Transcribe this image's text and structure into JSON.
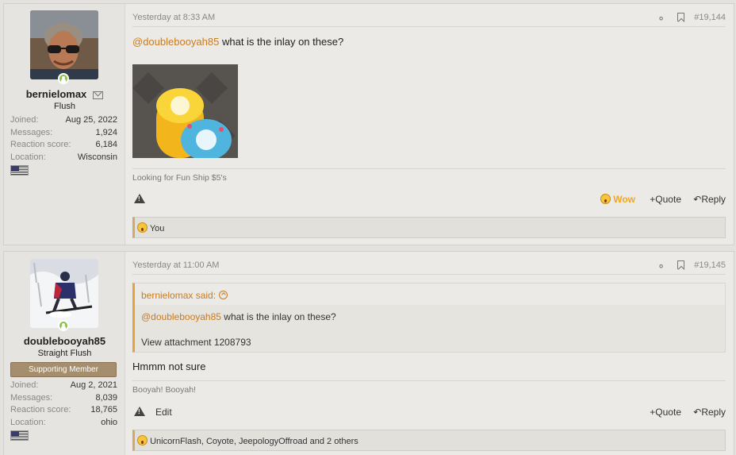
{
  "posts": [
    {
      "user": {
        "name": "bernielomax",
        "title": "Flush",
        "stats": [
          {
            "label": "Joined:",
            "value": "Aug 25, 2022"
          },
          {
            "label": "Messages:",
            "value": "1,924"
          },
          {
            "label": "Reaction score:",
            "value": "6,184"
          },
          {
            "label": "Location:",
            "value": "Wisconsin"
          }
        ]
      },
      "date": "Yesterday at 8:33 AM",
      "number": "#19,144",
      "mention": "@doublebooyah85",
      "text": " what is the inlay on these?",
      "signature": "Looking for Fun Ship $5's",
      "actions": {
        "wow": "Wow",
        "quote": "Quote",
        "reply": "Reply"
      },
      "reactions": "You"
    },
    {
      "user": {
        "name": "doublebooyah85",
        "title": "Straight Flush",
        "banner": "Supporting Member",
        "stats": [
          {
            "label": "Joined:",
            "value": "Aug 2, 2021"
          },
          {
            "label": "Messages:",
            "value": "8,039"
          },
          {
            "label": "Reaction score:",
            "value": "18,765"
          },
          {
            "label": "Location:",
            "value": "ohio"
          }
        ]
      },
      "date": "Yesterday at 11:00 AM",
      "number": "#19,145",
      "quote": {
        "author": "bernielomax said:",
        "mention": "@doublebooyah85",
        "text": " what is the inlay on these?",
        "attachment": "View attachment 1208793"
      },
      "text": "Hmmm not sure",
      "signature": "Booyah! Booyah!",
      "actions": {
        "edit": "Edit",
        "quote": "Quote",
        "reply": "Reply"
      },
      "reactions": "UnicornFlash, Coyote, JeepologyOffroad and 2 others"
    }
  ]
}
